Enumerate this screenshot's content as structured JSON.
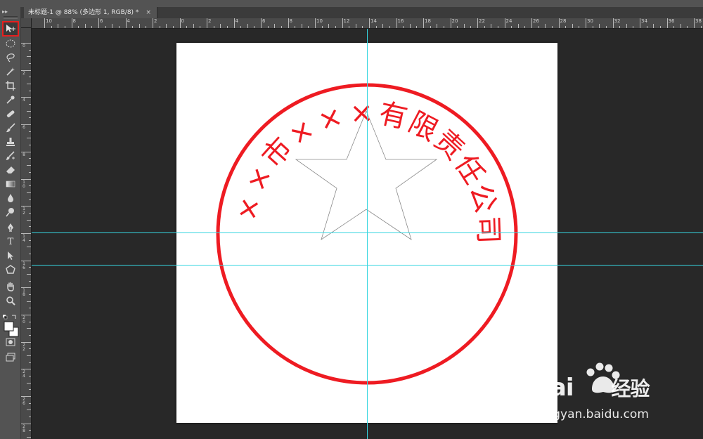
{
  "document_tab": {
    "title": "未标题-1 @ 88% (多边形 1, RGB/8) *",
    "close": "×"
  },
  "rulers": {
    "horizontal": [
      "10",
      "8",
      "6",
      "4",
      "2",
      "0",
      "2",
      "4",
      "6",
      "8",
      "10",
      "12",
      "14",
      "16",
      "18",
      "20",
      "22",
      "24",
      "26",
      "28",
      "30",
      "32",
      "34",
      "36",
      "38"
    ],
    "vertical": [
      "0",
      "2",
      "4",
      "6",
      "8",
      "10",
      "12",
      "14",
      "16",
      "18",
      "20",
      "22",
      "24",
      "26",
      "28"
    ]
  },
  "tools": [
    {
      "name": "move-tool",
      "icon": "move-icon",
      "selected": true
    },
    {
      "name": "marquee-tool",
      "icon": "ellipse-marquee-icon"
    },
    {
      "name": "lasso-tool",
      "icon": "lasso-icon"
    },
    {
      "name": "magic-wand-tool",
      "icon": "magic-wand-icon"
    },
    {
      "name": "crop-tool",
      "icon": "crop-icon"
    },
    {
      "name": "eyedropper-tool",
      "icon": "eyedropper-icon"
    },
    {
      "name": "healing-brush-tool",
      "icon": "bandage-icon"
    },
    {
      "name": "brush-tool",
      "icon": "brush-icon"
    },
    {
      "name": "clone-stamp-tool",
      "icon": "stamp-icon"
    },
    {
      "name": "history-brush-tool",
      "icon": "history-brush-icon"
    },
    {
      "name": "eraser-tool",
      "icon": "eraser-icon"
    },
    {
      "name": "gradient-tool",
      "icon": "gradient-icon"
    },
    {
      "name": "blur-tool",
      "icon": "drop-icon"
    },
    {
      "name": "dodge-tool",
      "icon": "dodge-icon"
    },
    {
      "name": "pen-tool",
      "icon": "pen-icon"
    },
    {
      "name": "type-tool",
      "icon": "type-icon",
      "label": "T"
    },
    {
      "name": "path-selection-tool",
      "icon": "path-select-icon"
    },
    {
      "name": "shape-tool",
      "icon": "polygon-icon"
    },
    {
      "name": "hand-tool",
      "icon": "hand-icon"
    },
    {
      "name": "zoom-tool",
      "icon": "zoom-icon"
    }
  ],
  "colors": {
    "foreground": "#ffffff",
    "background": "#ffffff",
    "stamp_red": "#ee1b22",
    "guide": "#36d6e0"
  },
  "stamp": {
    "arc_chars": [
      "×",
      "×",
      "市",
      "×",
      "×",
      "×",
      "有",
      "限",
      "责",
      "任",
      "公",
      "司"
    ]
  },
  "watermark": {
    "brand": "Bai",
    "brand_suffix": "经验",
    "url": "jingyan.baidu.com"
  }
}
